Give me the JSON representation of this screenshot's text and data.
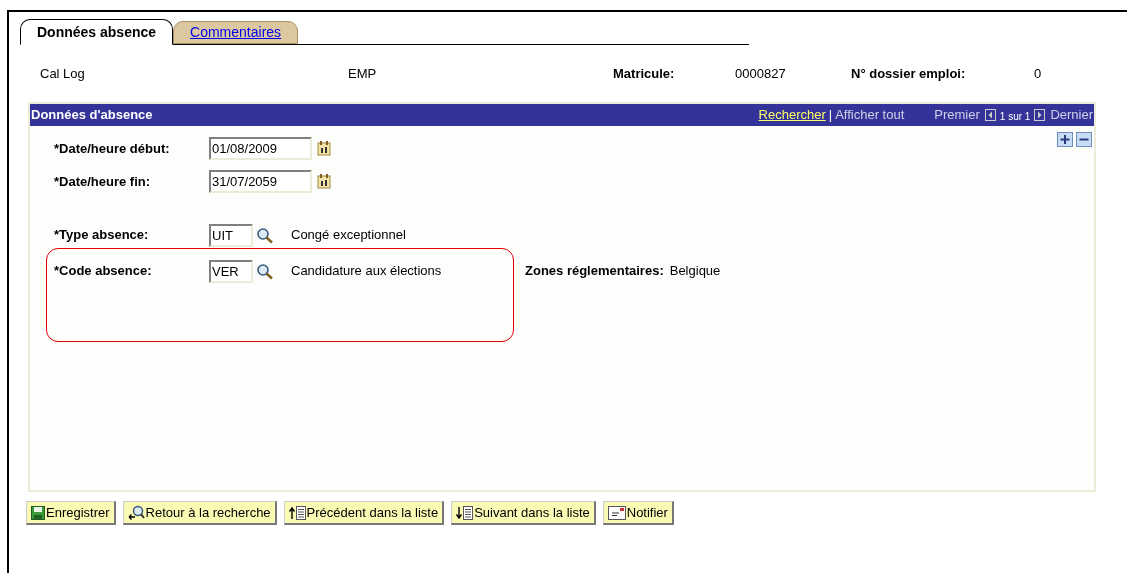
{
  "tabs": [
    {
      "label": "Données absence",
      "selected": true
    },
    {
      "label": "Commentaires",
      "selected": false
    }
  ],
  "header": {
    "name": "Cal Log",
    "type": "EMP",
    "fields": [
      {
        "label": "Matricule:",
        "value": "0000827"
      },
      {
        "label": "N° dossier emploi:",
        "value": "0"
      }
    ]
  },
  "panel": {
    "title": "Données d'absence",
    "search_link": "Rechercher",
    "separator": "|",
    "show_all": "Afficher tout",
    "first": "Premier",
    "position": "1 sur 1",
    "last": "Dernier",
    "dates": [
      {
        "label": "*Date/heure début:",
        "value": "01/08/2009"
      },
      {
        "label": "*Date/heure fin:",
        "value": "31/07/2059"
      }
    ],
    "lookups": [
      {
        "label": "*Type absence:",
        "value": "UIT",
        "description": "Congé exceptionnel"
      },
      {
        "label": "*Code absence:",
        "value": "VER",
        "description": "Candidature aux élections",
        "extra_label": "Zones réglementaires:",
        "extra_value": "Belgique"
      }
    ]
  },
  "buttons": [
    {
      "kind": "save",
      "label": "Enregistrer"
    },
    {
      "kind": "search",
      "label": "Retour à la recherche"
    },
    {
      "kind": "prev",
      "label": "Précédent dans la liste"
    },
    {
      "kind": "next",
      "label": "Suivant dans la liste"
    },
    {
      "kind": "notify",
      "label": "Notifier"
    }
  ]
}
